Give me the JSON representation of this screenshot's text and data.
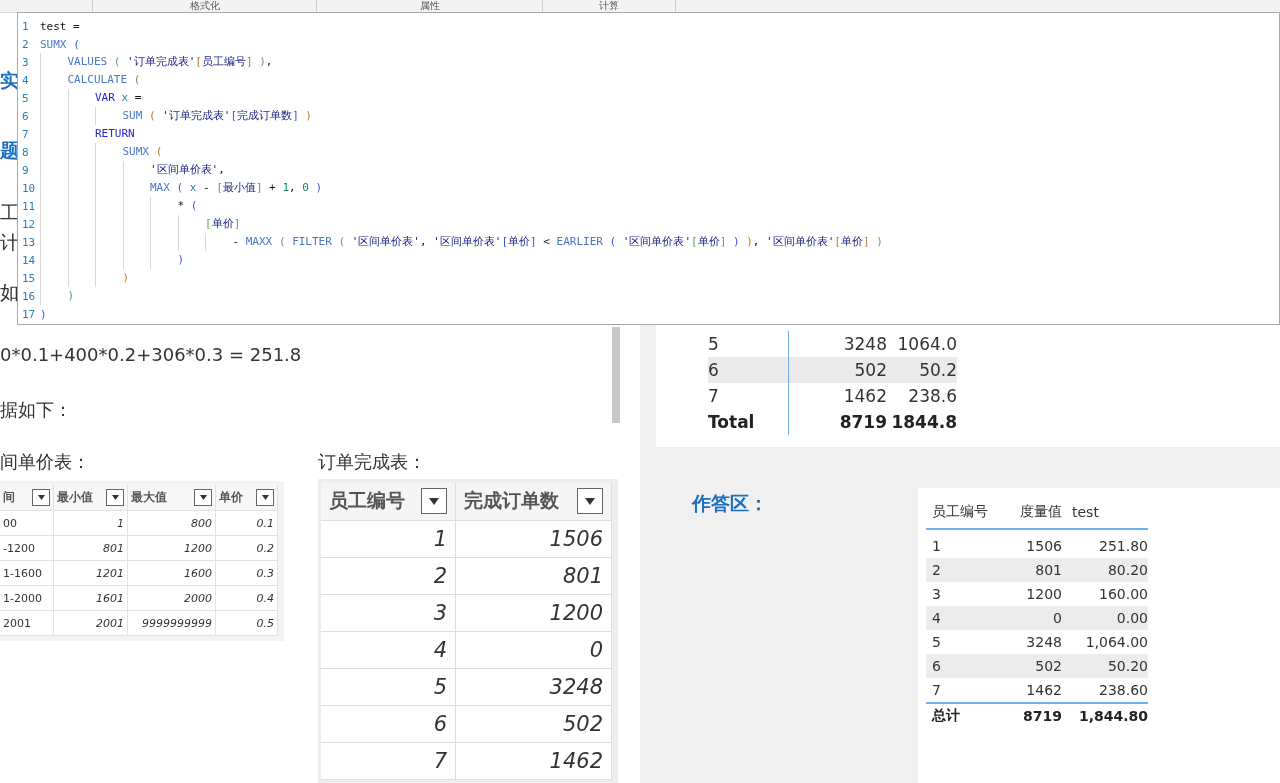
{
  "ribbon": {
    "tabs": [
      "格式化",
      "属性",
      "计算"
    ]
  },
  "editor": {
    "lines": [
      {
        "number": "1",
        "tokens": [
          {
            "t": "test =",
            "kind": "plain"
          }
        ]
      },
      {
        "number": "2",
        "tokens": [
          {
            "t": "SUMX ",
            "kind": "func"
          },
          {
            "t": "(",
            "kind": "br1"
          }
        ]
      },
      {
        "number": "3",
        "tokens": [
          {
            "t": "    VALUES ",
            "kind": "func"
          },
          {
            "t": "( ",
            "kind": "br2"
          },
          {
            "t": "'订单完成表'",
            "kind": "str"
          },
          {
            "t": "[",
            "kind": "br3"
          },
          {
            "t": "员工编号",
            "kind": "str"
          },
          {
            "t": "]",
            "kind": "br3"
          },
          {
            "t": " )",
            "kind": "br2"
          },
          {
            "t": ",",
            "kind": "plain"
          }
        ]
      },
      {
        "number": "4",
        "tokens": [
          {
            "t": "    CALCULATE ",
            "kind": "func"
          },
          {
            "t": "(",
            "kind": "br2"
          }
        ]
      },
      {
        "number": "5",
        "tokens": [
          {
            "t": "        VAR ",
            "kind": "kw"
          },
          {
            "t": "x",
            "kind": "var"
          },
          {
            "t": " =",
            "kind": "plain"
          }
        ]
      },
      {
        "number": "6",
        "tokens": [
          {
            "t": "            SUM ",
            "kind": "func"
          },
          {
            "t": "( ",
            "kind": "br3"
          },
          {
            "t": "'订单完成表'",
            "kind": "str"
          },
          {
            "t": "[",
            "kind": "br1"
          },
          {
            "t": "完成订单数",
            "kind": "str"
          },
          {
            "t": "]",
            "kind": "br1"
          },
          {
            "t": " )",
            "kind": "br3"
          }
        ]
      },
      {
        "number": "7",
        "tokens": [
          {
            "t": "        RETURN",
            "kind": "kw"
          }
        ]
      },
      {
        "number": "8",
        "tokens": [
          {
            "t": "            SUMX ",
            "kind": "func"
          },
          {
            "t": "(",
            "kind": "br3"
          }
        ]
      },
      {
        "number": "9",
        "tokens": [
          {
            "t": "                '区间单价表'",
            "kind": "str"
          },
          {
            "t": ",",
            "kind": "plain"
          }
        ]
      },
      {
        "number": "10",
        "tokens": [
          {
            "t": "                MAX ",
            "kind": "func"
          },
          {
            "t": "( ",
            "kind": "br1"
          },
          {
            "t": "x",
            "kind": "var"
          },
          {
            "t": " - ",
            "kind": "plain"
          },
          {
            "t": "[",
            "kind": "br2"
          },
          {
            "t": "最小值",
            "kind": "str"
          },
          {
            "t": "]",
            "kind": "br2"
          },
          {
            "t": " + ",
            "kind": "plain"
          },
          {
            "t": "1",
            "kind": "num"
          },
          {
            "t": ", ",
            "kind": "plain"
          },
          {
            "t": "0",
            "kind": "num"
          },
          {
            "t": " )",
            "kind": "br1"
          }
        ]
      },
      {
        "number": "11",
        "tokens": [
          {
            "t": "                    * ",
            "kind": "plain"
          },
          {
            "t": "(",
            "kind": "br1"
          }
        ]
      },
      {
        "number": "12",
        "tokens": [
          {
            "t": "                        [",
            "kind": "br2"
          },
          {
            "t": "单价",
            "kind": "str"
          },
          {
            "t": "]",
            "kind": "br2"
          }
        ]
      },
      {
        "number": "13",
        "tokens": [
          {
            "t": "                            - ",
            "kind": "plain"
          },
          {
            "t": "MAXX ",
            "kind": "func"
          },
          {
            "t": "( ",
            "kind": "br2"
          },
          {
            "t": "FILTER ",
            "kind": "func"
          },
          {
            "t": "( ",
            "kind": "br3"
          },
          {
            "t": "'区间单价表'",
            "kind": "str"
          },
          {
            "t": ", ",
            "kind": "plain"
          },
          {
            "t": "'区间单价表'",
            "kind": "str"
          },
          {
            "t": "[",
            "kind": "br1"
          },
          {
            "t": "单价",
            "kind": "str"
          },
          {
            "t": "]",
            "kind": "br1"
          },
          {
            "t": " < ",
            "kind": "plain"
          },
          {
            "t": "EARLIER ",
            "kind": "func"
          },
          {
            "t": "( ",
            "kind": "br1"
          },
          {
            "t": "'区间单价表'",
            "kind": "str"
          },
          {
            "t": "[",
            "kind": "br2"
          },
          {
            "t": "单价",
            "kind": "str"
          },
          {
            "t": "]",
            "kind": "br2"
          },
          {
            "t": " )",
            "kind": "br1"
          },
          {
            "t": " )",
            "kind": "br3"
          },
          {
            "t": ", ",
            "kind": "plain"
          },
          {
            "t": "'区间单价表'",
            "kind": "str"
          },
          {
            "t": "[",
            "kind": "br3"
          },
          {
            "t": "单价",
            "kind": "str"
          },
          {
            "t": "]",
            "kind": "br3"
          },
          {
            "t": " )",
            "kind": "br2"
          }
        ]
      },
      {
        "number": "14",
        "tokens": [
          {
            "t": "                    )",
            "kind": "br1"
          }
        ]
      },
      {
        "number": "15",
        "tokens": [
          {
            "t": "            )",
            "kind": "br3"
          }
        ]
      },
      {
        "number": "16",
        "tokens": [
          {
            "t": "    )",
            "kind": "br2"
          }
        ]
      },
      {
        "number": "17",
        "tokens": [
          {
            "t": ")",
            "kind": "br1"
          }
        ]
      }
    ]
  },
  "page": {
    "fragments": [
      {
        "text": "实",
        "kind": "heading"
      },
      {
        "text": "题",
        "kind": "heading"
      },
      {
        "text": "工",
        "kind": "body"
      },
      {
        "text": "计",
        "kind": "body"
      },
      {
        "text": "如",
        "kind": "body"
      }
    ],
    "formula": "0*0.1+400*0.2+306*0.3 = 251.8",
    "data_intro": "据如下：",
    "price_table": {
      "title": "间单价表：",
      "columns": [
        "间",
        "最小值",
        "最大值",
        "单价"
      ],
      "rows": [
        [
          "00",
          "1",
          "800",
          "0.1"
        ],
        [
          "-1200",
          "801",
          "1200",
          "0.2"
        ],
        [
          "1-1600",
          "1201",
          "1600",
          "0.3"
        ],
        [
          "1-2000",
          "1601",
          "2000",
          "0.4"
        ],
        [
          "2001",
          "2001",
          "9999999999",
          "0.5"
        ]
      ]
    },
    "order_table": {
      "title": "订单完成表：",
      "columns": [
        "员工编号",
        "完成订单数"
      ],
      "rows": [
        [
          "1",
          "1506"
        ],
        [
          "2",
          "801"
        ],
        [
          "3",
          "1200"
        ],
        [
          "4",
          "0"
        ],
        [
          "5",
          "3248"
        ],
        [
          "6",
          "502"
        ],
        [
          "7",
          "1462"
        ]
      ]
    }
  },
  "result_card": {
    "rows": [
      [
        "5",
        "3248",
        "1064.0"
      ],
      [
        "6",
        "502",
        "50.2"
      ],
      [
        "7",
        "1462",
        "238.6"
      ]
    ],
    "total": [
      "Total",
      "8719",
      "1844.8"
    ]
  },
  "answer": {
    "title": "作答区：",
    "columns": [
      "员工编号",
      "度量值",
      "test"
    ],
    "rows": [
      [
        "1",
        "1506",
        "251.80"
      ],
      [
        "2",
        "801",
        "80.20"
      ],
      [
        "3",
        "1200",
        "160.00"
      ],
      [
        "4",
        "0",
        "0.00"
      ],
      [
        "5",
        "3248",
        "1,064.00"
      ],
      [
        "6",
        "502",
        "50.20"
      ],
      [
        "7",
        "1462",
        "238.60"
      ]
    ],
    "total": [
      "总计",
      "8719",
      "1,844.80"
    ]
  }
}
